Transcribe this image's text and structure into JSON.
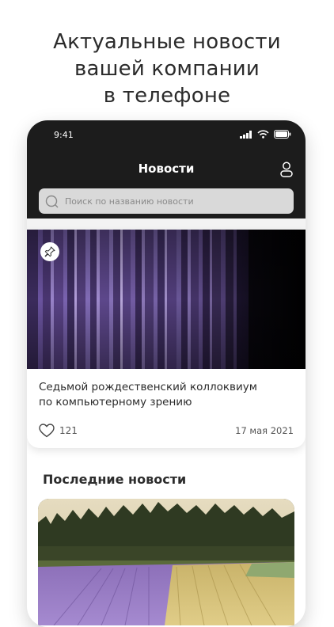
{
  "promo": {
    "line1": "Актуальные новости",
    "line2": "вашей компании",
    "line3": "в телефоне"
  },
  "status_bar": {
    "time": "9:41",
    "icons": [
      "signal-icon",
      "wifi-icon",
      "battery-icon"
    ]
  },
  "nav": {
    "title": "Новости",
    "profile_icon": "person-icon"
  },
  "search": {
    "placeholder": "Поиск по названию новости",
    "icon": "search-icon"
  },
  "featured": {
    "title_line1": "Седьмой рождественский коллоквиум",
    "title_line2": "по компьютерному зрению",
    "likes": "121",
    "date": "17 мая 2021",
    "pin_icon": "pin-icon",
    "like_icon": "heart-icon"
  },
  "latest": {
    "heading": "Последние новости"
  },
  "colors": {
    "topbar": "#1c1c1c",
    "search_bg": "#d9d9d9",
    "accent_purple": "#6a4aa0"
  }
}
